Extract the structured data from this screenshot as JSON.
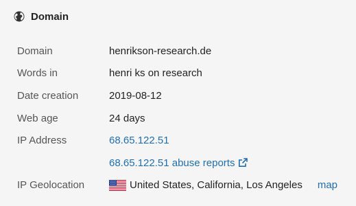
{
  "header": {
    "title": "Domain",
    "icon": "globe-icon"
  },
  "rows": [
    {
      "label": "Domain",
      "value": "henrikson-research.de"
    },
    {
      "label": "Words in",
      "value": "henri ks on research"
    },
    {
      "label": "Date creation",
      "value": "2019-08-12"
    },
    {
      "label": "Web age",
      "value": "24 days"
    },
    {
      "label": "IP Address",
      "value": "68.65.122.51"
    },
    {
      "label": "",
      "value": "68.65.122.51 abuse reports",
      "icon": "external-link-icon"
    },
    {
      "label": "IP Geolocation",
      "value": "United States, California, Los Angeles",
      "flag": "us-flag-icon",
      "link": "map"
    }
  ],
  "colors": {
    "link": "#1f6fb2",
    "background": "#f5f5f5",
    "text": "#222222",
    "label": "#555555"
  }
}
